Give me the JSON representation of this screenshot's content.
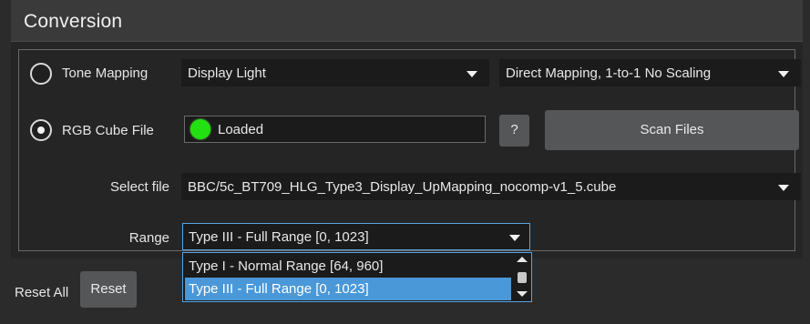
{
  "header": {
    "title": "Conversion"
  },
  "tone_mapping": {
    "label": "Tone Mapping",
    "selected": false,
    "mode": "Display Light",
    "mapping": "Direct Mapping, 1-to-1 No Scaling"
  },
  "rgb_cube": {
    "label": "RGB Cube File",
    "selected": true,
    "status": "Loaded",
    "status_color": "#22e011",
    "help_label": "?",
    "scan_label": "Scan Files"
  },
  "select_file": {
    "label": "Select file",
    "value": "BBC/5c_BT709_HLG_Type3_Display_UpMapping_nocomp-v1_5.cube"
  },
  "range": {
    "label": "Range",
    "value": "Type III - Full Range [0, 1023]",
    "options": [
      {
        "label": "Type I - Normal Range [64, 960]",
        "selected": false
      },
      {
        "label": "Type III - Full Range [0, 1023]",
        "selected": true
      }
    ]
  },
  "footer": {
    "reset_all_label": "Reset All",
    "reset_label": "Reset"
  },
  "colors": {
    "accent": "#4a98d8",
    "focus_border": "#5aa4e0",
    "background": "#2b2b2b",
    "panel": "#252525"
  }
}
